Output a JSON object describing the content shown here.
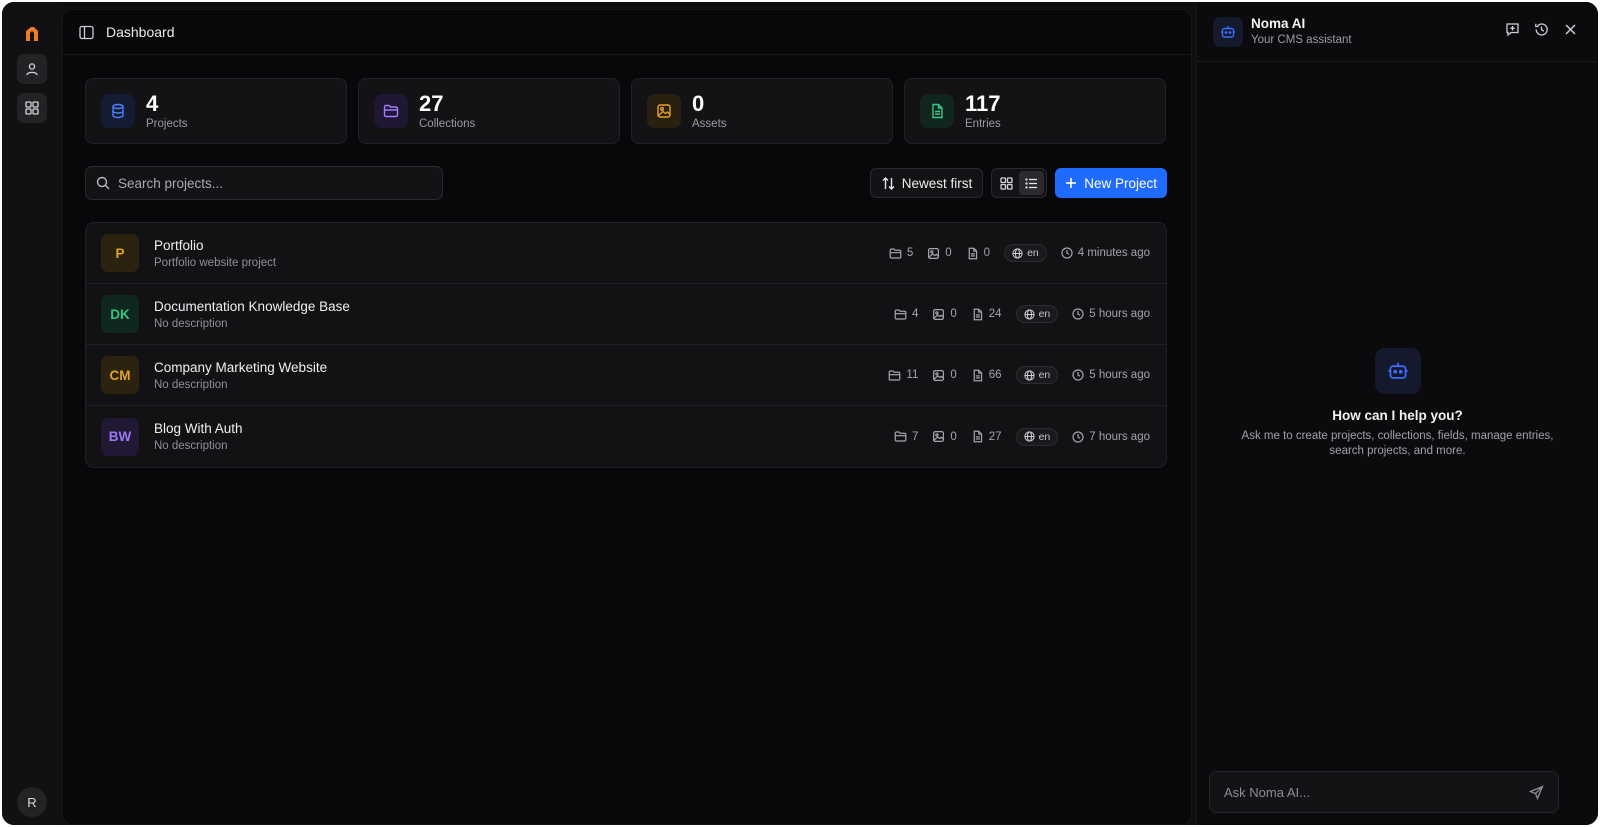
{
  "header": {
    "title": "Dashboard"
  },
  "rail": {
    "avatar_initial": "R"
  },
  "stats": [
    {
      "value": "4",
      "label": "Projects",
      "icon": "database-icon",
      "color": "#4f7dff",
      "bg": "#141c33"
    },
    {
      "value": "27",
      "label": "Collections",
      "icon": "folder-icon",
      "color": "#a57bff",
      "bg": "#1f1631"
    },
    {
      "value": "0",
      "label": "Assets",
      "icon": "image-icon",
      "color": "#e5a325",
      "bg": "#2a200f"
    },
    {
      "value": "117",
      "label": "Entries",
      "icon": "document-icon",
      "color": "#34c98b",
      "bg": "#10261c"
    }
  ],
  "search": {
    "placeholder": "Search projects..."
  },
  "toolbar": {
    "sort_label": "Newest first",
    "new_label": "New Project"
  },
  "projects": [
    {
      "initials": "P",
      "name": "Portfolio",
      "description": "Portfolio website project",
      "collections": "5",
      "assets": "0",
      "entries": "0",
      "lang": "en",
      "time": "4 minutes ago",
      "badge_fg": "#e0a22b",
      "badge_bg": "#2c2210"
    },
    {
      "initials": "DK",
      "name": "Documentation Knowledge Base",
      "description": "No description",
      "collections": "4",
      "assets": "0",
      "entries": "24",
      "lang": "en",
      "time": "5 hours ago",
      "badge_fg": "#33c486",
      "badge_bg": "#10271d"
    },
    {
      "initials": "CM",
      "name": "Company Marketing Website",
      "description": "No description",
      "collections": "11",
      "assets": "0",
      "entries": "66",
      "lang": "en",
      "time": "5 hours ago",
      "badge_fg": "#e0a22b",
      "badge_bg": "#2c2210"
    },
    {
      "initials": "BW",
      "name": "Blog With Auth",
      "description": "No description",
      "collections": "7",
      "assets": "0",
      "entries": "27",
      "lang": "en",
      "time": "7 hours ago",
      "badge_fg": "#9c78f2",
      "badge_bg": "#211834"
    }
  ],
  "ai": {
    "name": "Noma AI",
    "subtitle": "Your CMS assistant",
    "empty_title": "How can I help you?",
    "empty_desc": "Ask me to create projects, collections, fields, manage entries, search projects, and more.",
    "input_placeholder": "Ask Noma AI..."
  }
}
